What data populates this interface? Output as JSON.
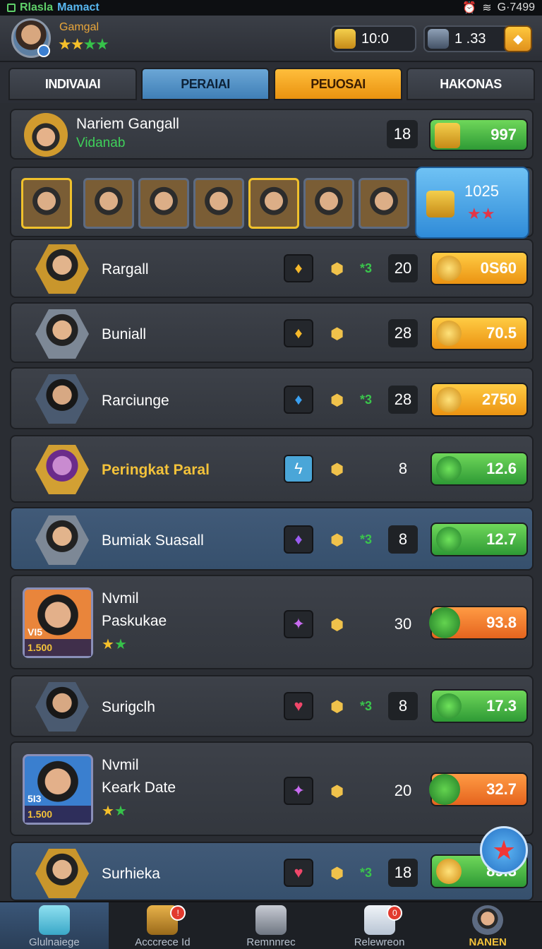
{
  "status_bar": {
    "app_name_1": "Rlasla",
    "app_name_2": "Mamact",
    "signal": "G·7499"
  },
  "header": {
    "player_name": "Gamgal",
    "rank_stars": "★★★★",
    "currency_1": "10:0",
    "currency_2": "1 .33"
  },
  "tabs": [
    {
      "label": "INDIVAIAI"
    },
    {
      "label": "PERAIAI"
    },
    {
      "label": "PEUOSAI"
    },
    {
      "label": "HAKONAS"
    }
  ],
  "top_player": {
    "name": "Nariem Gangall",
    "subtitle": "Vidanab",
    "level": "18",
    "score": "997"
  },
  "team_bubble": {
    "value": "1025",
    "stars": "★★"
  },
  "rows": [
    {
      "name": "Rargall",
      "multiplier": "*3",
      "level": "20",
      "score": "0S60",
      "gem": "♦"
    },
    {
      "name": "Buniall",
      "multiplier": "",
      "level": "28",
      "score": "70.5",
      "gem": "♦"
    },
    {
      "name": "Rarciunge",
      "multiplier": "*3",
      "level": "28",
      "score": "2750",
      "gem": "♦"
    },
    {
      "name": "Peringkat Paral",
      "multiplier": "",
      "level": "8",
      "score": "12.6",
      "gem": "ϟ"
    },
    {
      "name": "Bumiak Suasall",
      "multiplier": "*3",
      "level": "8",
      "score": "12.7",
      "gem": "♦"
    },
    {
      "name": "Nvmil",
      "name2": "Paskukae",
      "tag": "VI5",
      "price": "1.500",
      "multiplier": "",
      "level": "30",
      "score": "93.8",
      "gem": "✦"
    },
    {
      "name": "Surigclh",
      "multiplier": "*3",
      "level": "8",
      "score": "17.3",
      "gem": "♥"
    },
    {
      "name": "Nvmil",
      "name2": "Keark Date",
      "tag": "5I3",
      "price": "1.500",
      "multiplier": "",
      "level": "20",
      "score": "32.7",
      "gem": "✦"
    },
    {
      "name": "Surhieka",
      "multiplier": "*3",
      "level": "18",
      "score": "89.3",
      "gem": "♥"
    }
  ],
  "bottom_nav": [
    {
      "label": "Glulnaiege",
      "icon": "home-icon"
    },
    {
      "label": "Acccrece Id",
      "icon": "box-icon",
      "badge": ""
    },
    {
      "label": "Remnnrec",
      "icon": "tools-icon"
    },
    {
      "label": "Relewreon",
      "icon": "dice-icon",
      "badge": "0"
    },
    {
      "label": "NANEN",
      "icon": "profile-icon"
    }
  ],
  "colors": {
    "green": "#2e9a35",
    "orange": "#eb9312",
    "blue": "#3f7fb6",
    "gold": "#f3c23a"
  }
}
